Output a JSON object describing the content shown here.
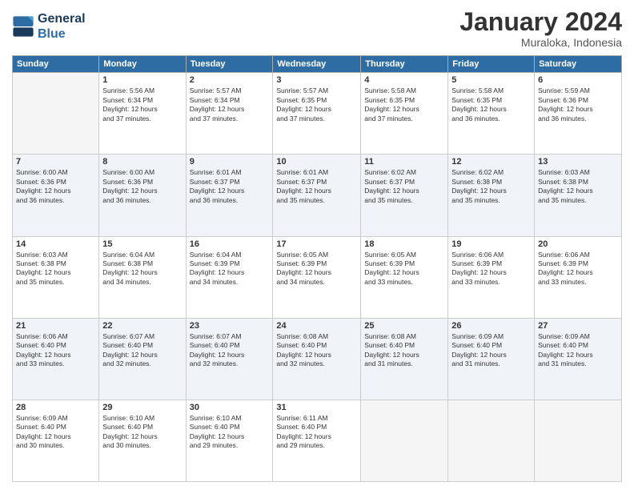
{
  "header": {
    "logo_line1": "General",
    "logo_line2": "Blue",
    "month": "January 2024",
    "location": "Muraloka, Indonesia"
  },
  "days_of_week": [
    "Sunday",
    "Monday",
    "Tuesday",
    "Wednesday",
    "Thursday",
    "Friday",
    "Saturday"
  ],
  "weeks": [
    [
      {
        "day": "",
        "info": ""
      },
      {
        "day": "1",
        "info": "Sunrise: 5:56 AM\nSunset: 6:34 PM\nDaylight: 12 hours\nand 37 minutes."
      },
      {
        "day": "2",
        "info": "Sunrise: 5:57 AM\nSunset: 6:34 PM\nDaylight: 12 hours\nand 37 minutes."
      },
      {
        "day": "3",
        "info": "Sunrise: 5:57 AM\nSunset: 6:35 PM\nDaylight: 12 hours\nand 37 minutes."
      },
      {
        "day": "4",
        "info": "Sunrise: 5:58 AM\nSunset: 6:35 PM\nDaylight: 12 hours\nand 37 minutes."
      },
      {
        "day": "5",
        "info": "Sunrise: 5:58 AM\nSunset: 6:35 PM\nDaylight: 12 hours\nand 36 minutes."
      },
      {
        "day": "6",
        "info": "Sunrise: 5:59 AM\nSunset: 6:36 PM\nDaylight: 12 hours\nand 36 minutes."
      }
    ],
    [
      {
        "day": "7",
        "info": "Sunrise: 6:00 AM\nSunset: 6:36 PM\nDaylight: 12 hours\nand 36 minutes."
      },
      {
        "day": "8",
        "info": "Sunrise: 6:00 AM\nSunset: 6:36 PM\nDaylight: 12 hours\nand 36 minutes."
      },
      {
        "day": "9",
        "info": "Sunrise: 6:01 AM\nSunset: 6:37 PM\nDaylight: 12 hours\nand 36 minutes."
      },
      {
        "day": "10",
        "info": "Sunrise: 6:01 AM\nSunset: 6:37 PM\nDaylight: 12 hours\nand 35 minutes."
      },
      {
        "day": "11",
        "info": "Sunrise: 6:02 AM\nSunset: 6:37 PM\nDaylight: 12 hours\nand 35 minutes."
      },
      {
        "day": "12",
        "info": "Sunrise: 6:02 AM\nSunset: 6:38 PM\nDaylight: 12 hours\nand 35 minutes."
      },
      {
        "day": "13",
        "info": "Sunrise: 6:03 AM\nSunset: 6:38 PM\nDaylight: 12 hours\nand 35 minutes."
      }
    ],
    [
      {
        "day": "14",
        "info": "Sunrise: 6:03 AM\nSunset: 6:38 PM\nDaylight: 12 hours\nand 35 minutes."
      },
      {
        "day": "15",
        "info": "Sunrise: 6:04 AM\nSunset: 6:38 PM\nDaylight: 12 hours\nand 34 minutes."
      },
      {
        "day": "16",
        "info": "Sunrise: 6:04 AM\nSunset: 6:39 PM\nDaylight: 12 hours\nand 34 minutes."
      },
      {
        "day": "17",
        "info": "Sunrise: 6:05 AM\nSunset: 6:39 PM\nDaylight: 12 hours\nand 34 minutes."
      },
      {
        "day": "18",
        "info": "Sunrise: 6:05 AM\nSunset: 6:39 PM\nDaylight: 12 hours\nand 33 minutes."
      },
      {
        "day": "19",
        "info": "Sunrise: 6:06 AM\nSunset: 6:39 PM\nDaylight: 12 hours\nand 33 minutes."
      },
      {
        "day": "20",
        "info": "Sunrise: 6:06 AM\nSunset: 6:39 PM\nDaylight: 12 hours\nand 33 minutes."
      }
    ],
    [
      {
        "day": "21",
        "info": "Sunrise: 6:06 AM\nSunset: 6:40 PM\nDaylight: 12 hours\nand 33 minutes."
      },
      {
        "day": "22",
        "info": "Sunrise: 6:07 AM\nSunset: 6:40 PM\nDaylight: 12 hours\nand 32 minutes."
      },
      {
        "day": "23",
        "info": "Sunrise: 6:07 AM\nSunset: 6:40 PM\nDaylight: 12 hours\nand 32 minutes."
      },
      {
        "day": "24",
        "info": "Sunrise: 6:08 AM\nSunset: 6:40 PM\nDaylight: 12 hours\nand 32 minutes."
      },
      {
        "day": "25",
        "info": "Sunrise: 6:08 AM\nSunset: 6:40 PM\nDaylight: 12 hours\nand 31 minutes."
      },
      {
        "day": "26",
        "info": "Sunrise: 6:09 AM\nSunset: 6:40 PM\nDaylight: 12 hours\nand 31 minutes."
      },
      {
        "day": "27",
        "info": "Sunrise: 6:09 AM\nSunset: 6:40 PM\nDaylight: 12 hours\nand 31 minutes."
      }
    ],
    [
      {
        "day": "28",
        "info": "Sunrise: 6:09 AM\nSunset: 6:40 PM\nDaylight: 12 hours\nand 30 minutes."
      },
      {
        "day": "29",
        "info": "Sunrise: 6:10 AM\nSunset: 6:40 PM\nDaylight: 12 hours\nand 30 minutes."
      },
      {
        "day": "30",
        "info": "Sunrise: 6:10 AM\nSunset: 6:40 PM\nDaylight: 12 hours\nand 29 minutes."
      },
      {
        "day": "31",
        "info": "Sunrise: 6:11 AM\nSunset: 6:40 PM\nDaylight: 12 hours\nand 29 minutes."
      },
      {
        "day": "",
        "info": ""
      },
      {
        "day": "",
        "info": ""
      },
      {
        "day": "",
        "info": ""
      }
    ]
  ]
}
